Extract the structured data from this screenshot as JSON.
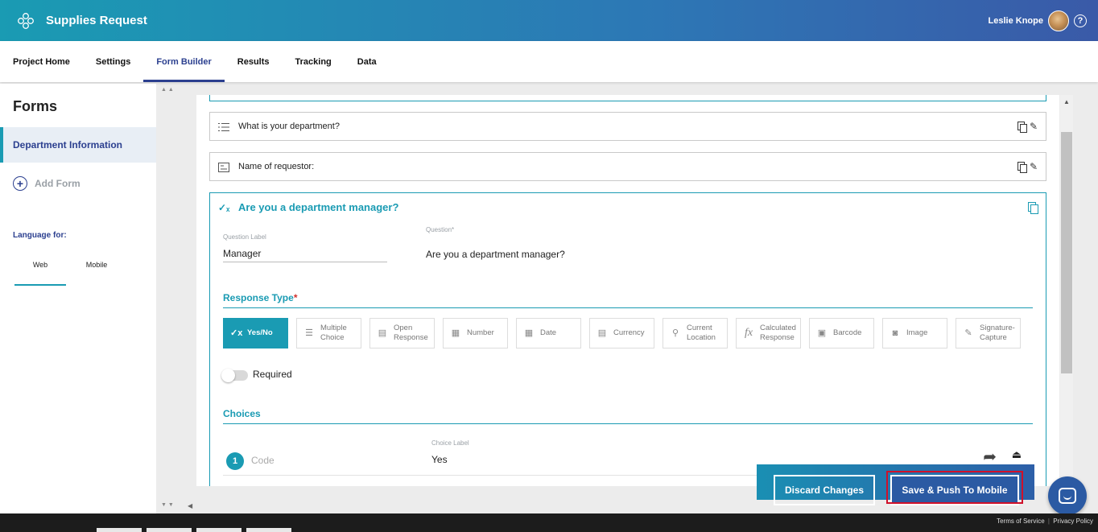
{
  "header": {
    "app_title": "Supplies Request",
    "user_name": "Leslie Knope",
    "help_glyph": "?",
    "icons": {
      "logo": "flower-logo-icon",
      "help": "help-circle-icon"
    }
  },
  "nav": {
    "tabs": [
      {
        "label": "Project Home"
      },
      {
        "label": "Settings"
      },
      {
        "label": "Form Builder",
        "active": true
      },
      {
        "label": "Results"
      },
      {
        "label": "Tracking"
      },
      {
        "label": "Data"
      }
    ]
  },
  "sidebar": {
    "title": "Forms",
    "active_form": "Department Information",
    "add_form_label": "Add Form",
    "language_label": "Language for:",
    "language_tabs": [
      {
        "label": "Web",
        "active": true
      },
      {
        "label": "Mobile"
      }
    ]
  },
  "questions": [
    {
      "text": "What is your department?",
      "icon": "list-icon"
    },
    {
      "text": "Name of requestor:",
      "icon": "text-card-icon"
    }
  ],
  "expanded_question": {
    "title": "Are you a department manager?",
    "question_label_caption": "Question Label",
    "question_label_value": "Manager",
    "question_caption": "Question*",
    "question_value": "Are you a department manager?",
    "response_type_title": "Response Type",
    "required_mark": "*",
    "response_types": [
      {
        "label": "Yes/No",
        "icon": "yes-no-icon",
        "glyph": "✓x",
        "active": true
      },
      {
        "label": "Multiple Choice",
        "icon": "list-icon",
        "glyph": "☰"
      },
      {
        "label": "Open Response",
        "icon": "text-card-icon",
        "glyph": "▤"
      },
      {
        "label": "Number",
        "icon": "calculator-icon",
        "glyph": "▦"
      },
      {
        "label": "Date",
        "icon": "calendar-icon",
        "glyph": "▦"
      },
      {
        "label": "Currency",
        "icon": "currency-icon",
        "glyph": "▤"
      },
      {
        "label": "Current Location",
        "icon": "location-pin-icon",
        "glyph": "⚲"
      },
      {
        "label": "Calculated Response",
        "icon": "function-icon",
        "glyph": "fx"
      },
      {
        "label": "Barcode",
        "icon": "barcode-icon",
        "glyph": "▣"
      },
      {
        "label": "Image",
        "icon": "camera-icon",
        "glyph": "◙"
      },
      {
        "label": "Signature-Capture",
        "icon": "pen-icon",
        "glyph": "✎"
      }
    ],
    "required_label": "Required",
    "required_on": false,
    "choices_title": "Choices",
    "choices": [
      {
        "number": "1",
        "code_placeholder": "Code",
        "label_caption": "Choice Label",
        "label_value": "Yes"
      }
    ]
  },
  "actions": {
    "discard_label": "Discard Changes",
    "push_label": "Save & Push To Mobile"
  },
  "footer": {
    "terms": "Terms of Service",
    "separator": "|",
    "privacy": "Privacy Policy"
  },
  "colors": {
    "accent": "#1a9bb3",
    "brand_dark": "#2b3f8f",
    "highlight": "#d0102a"
  }
}
